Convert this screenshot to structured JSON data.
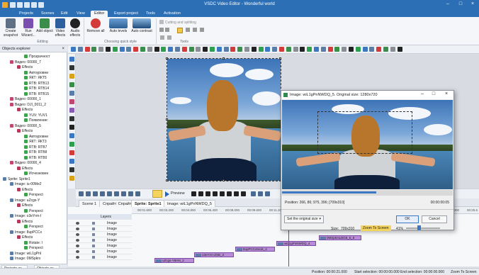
{
  "window": {
    "title": "VSDC Video Editor - Wonderful world"
  },
  "menu": {
    "tabs": [
      "Projects",
      "Scenes",
      "Edit",
      "View",
      "Editor",
      "Export project",
      "Tools",
      "Activation"
    ],
    "active": "Editor"
  },
  "ribbon": {
    "buttons": [
      {
        "label": "Create snapshot",
        "icon": "camera-icon"
      },
      {
        "label": "Run Wizard...",
        "icon": "wand-icon"
      },
      {
        "label": "Add object",
        "icon": "add-object-icon"
      },
      {
        "label": "Video effects",
        "icon": "video-effects-icon"
      },
      {
        "label": "Audio effects",
        "icon": "headphones-icon"
      },
      {
        "label": "Remove all",
        "icon": "remove-all-icon"
      },
      {
        "label": "Auto levels",
        "icon": "auto-levels-icon"
      },
      {
        "label": "Auto contrast",
        "icon": "auto-contrast-icon"
      }
    ],
    "groups": {
      "editing": "Editing",
      "quick_style": "Choosing quick style",
      "tools": "Tools"
    },
    "cutting_label": "Cutting and splitting"
  },
  "explorer": {
    "title": "Objects explorer",
    "rows": [
      {
        "text": "Прозрачност",
        "indent": 3,
        "color": "#3fa34d"
      },
      {
        "text": "Видео: 00000_7",
        "indent": 1,
        "color": "#c2476e"
      },
      {
        "text": "Effects",
        "indent": 2,
        "color": "#b53a5a"
      },
      {
        "text": "Автоуровни",
        "indent": 3,
        "color": "#3fa34d"
      },
      {
        "text": "ЯКТ: ЯКТ5",
        "indent": 3,
        "color": "#3fa34d"
      },
      {
        "text": "RTB: RTB13",
        "indent": 3,
        "color": "#3fa34d"
      },
      {
        "text": "RTB: RTB14",
        "indent": 3,
        "color": "#3fa34d"
      },
      {
        "text": "RTB: RTB15",
        "indent": 3,
        "color": "#3fa34d"
      },
      {
        "text": "Видео: 00000_1",
        "indent": 1,
        "color": "#c2476e"
      },
      {
        "text": "Видео: DJI_0011_2",
        "indent": 1,
        "color": "#c2476e"
      },
      {
        "text": "Effects",
        "indent": 2,
        "color": "#b53a5a"
      },
      {
        "text": "YUV: YUV1",
        "indent": 3,
        "color": "#3fa34d"
      },
      {
        "text": "Появление:",
        "indent": 3,
        "color": "#3fa34d"
      },
      {
        "text": "Видео: 00000_5",
        "indent": 1,
        "color": "#c2476e"
      },
      {
        "text": "Effects",
        "indent": 2,
        "color": "#b53a5a"
      },
      {
        "text": "Автоуровни",
        "indent": 3,
        "color": "#3fa34d"
      },
      {
        "text": "ЯКТ: ЯКТ3",
        "indent": 3,
        "color": "#3fa34d"
      },
      {
        "text": "RTB: RTB7",
        "indent": 3,
        "color": "#3fa34d"
      },
      {
        "text": "RTB: RTB8",
        "indent": 3,
        "color": "#3fa34d"
      },
      {
        "text": "RTB: RTB9",
        "indent": 3,
        "color": "#3fa34d"
      },
      {
        "text": "Видео: 00000_4",
        "indent": 1,
        "color": "#c2476e"
      },
      {
        "text": "Effects",
        "indent": 2,
        "color": "#b53a5a"
      },
      {
        "text": "Исчезновен",
        "indent": 3,
        "color": "#3fa34d"
      },
      {
        "text": "Sprite: Sprite1",
        "indent": 0,
        "color": "#5a7da8"
      },
      {
        "text": "Image: iu-00Me2",
        "indent": 1,
        "color": "#5a7da8"
      },
      {
        "text": "Effects",
        "indent": 2,
        "color": "#b53a5a"
      },
      {
        "text": "Perspect",
        "indent": 3,
        "color": "#3fa34d"
      },
      {
        "text": "Image: uZcgs-Y",
        "indent": 1,
        "color": "#5a7da8"
      },
      {
        "text": "Effects",
        "indent": 2,
        "color": "#b53a5a"
      },
      {
        "text": "Perspect",
        "indent": 3,
        "color": "#3fa34d"
      },
      {
        "text": "Image: o3eYrm-I",
        "indent": 1,
        "color": "#5a7da8"
      },
      {
        "text": "Effects",
        "indent": 2,
        "color": "#b53a5a"
      },
      {
        "text": "Perspect",
        "indent": 3,
        "color": "#3fa34d"
      },
      {
        "text": "Image: 8upPCCx",
        "indent": 1,
        "color": "#5a7da8"
      },
      {
        "text": "Effects",
        "indent": 2,
        "color": "#b53a5a"
      },
      {
        "text": "Rotate: I",
        "indent": 3,
        "color": "#3fa34d"
      },
      {
        "text": "Perspect",
        "indent": 3,
        "color": "#3fa34d"
      },
      {
        "text": "Image: wiL1gPnI",
        "indent": 1,
        "color": "#5a7da8"
      },
      {
        "text": "Image: 0MSpkrs",
        "indent": 1,
        "color": "#5a7da8"
      }
    ],
    "tabs": [
      "Projects ex...",
      "Objects ex..."
    ]
  },
  "preview": {
    "label": "Preview"
  },
  "scene_tabs": [
    "Scene 1",
    "Спрайт: Спрайт1",
    "Sprite: Sprite1",
    "Image: wiL1gPnNWDQ_5"
  ],
  "timeline": {
    "layers_label": "Layers",
    "rows": [
      "Image",
      "Image",
      "Image",
      "Image",
      "Image",
      "Image",
      "Image"
    ],
    "ticks": [
      "00:01.600",
      "00:03.200",
      "00:04.800",
      "00:06.400",
      "00:08.000",
      "00:09.600",
      "00:11.200",
      "00:12.800",
      "00:14.400",
      "00:16.000",
      "00:17.600",
      "00:19.200",
      "00:20.800",
      "00:22.400",
      "00:24.000",
      "00:25.6"
    ],
    "clips": [
      "0MSpkrsLBG8_6_6",
      "wiL1gPnNWDQ_4",
      "8upPCCx5s1k_4",
      "o3eYrm-ZSB_3",
      "uZcgs-Y6HN_2"
    ]
  },
  "statusbar": {
    "position": "Position:   00:00:21.000",
    "start": "Start selection:   00:00:00.000",
    "end": "End selection:   00:00:00.000",
    "zoom": "Zoom To Screen"
  },
  "dialog": {
    "title": "Image: wiL1gPnNWDQ_5. Original size: 1280x720",
    "position": "Position:   266, 86; 975, 396; [709x310]",
    "time": "00:00:00:05",
    "progress": 0.55,
    "set_original": "Set the original size",
    "size_label": "Size:",
    "size_value": "709x310",
    "zoom_to_screen": "Zoom To Screen",
    "zoom_value": "41%",
    "ok": "OK",
    "cancel": "Cancel"
  }
}
